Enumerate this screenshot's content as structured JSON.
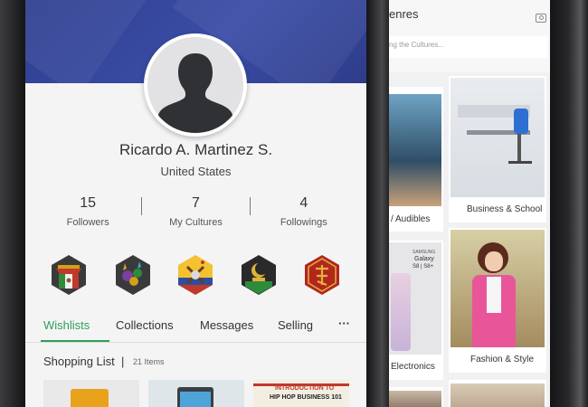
{
  "profile": {
    "name": "Ricardo A. Martinez S.",
    "country": "United States",
    "stats": [
      {
        "value": "15",
        "label": "Followers"
      },
      {
        "value": "7",
        "label": "My Cultures"
      },
      {
        "value": "4",
        "label": "Followings"
      }
    ],
    "badges": [
      {
        "icon": "mexico-culture-badge-icon"
      },
      {
        "icon": "mardi-gras-badge-icon"
      },
      {
        "icon": "colombia-music-badge-icon"
      },
      {
        "icon": "crescent-moon-badge-icon"
      },
      {
        "icon": "chinese-culture-badge-icon"
      }
    ],
    "tabs": [
      {
        "label": "Wishlists"
      },
      {
        "label": "Collections"
      },
      {
        "label": "Messages"
      },
      {
        "label": "Selling"
      },
      {
        "label": "···"
      }
    ],
    "list": {
      "title": "Shopping List",
      "separator": "|",
      "count": "21 Items"
    },
    "thumb_texts": {
      "book_line1": "INTRODUCTION TO",
      "book_line2": "HIP HOP BUSINESS 101"
    },
    "colors": {
      "accent": "#2f9e57",
      "cover": "#3a4ca6"
    }
  },
  "genres": {
    "title": "enres",
    "search_placeholder": "ng the Cultures...",
    "cards": [
      {
        "label": "/ Audibles"
      },
      {
        "label": "Business & School"
      },
      {
        "label": "Electronics"
      },
      {
        "label": "Fashion & Style"
      }
    ],
    "phone_text": {
      "brand": "SAMSUNG",
      "model": "Galaxy",
      "variant": "S8 | S8+"
    }
  }
}
